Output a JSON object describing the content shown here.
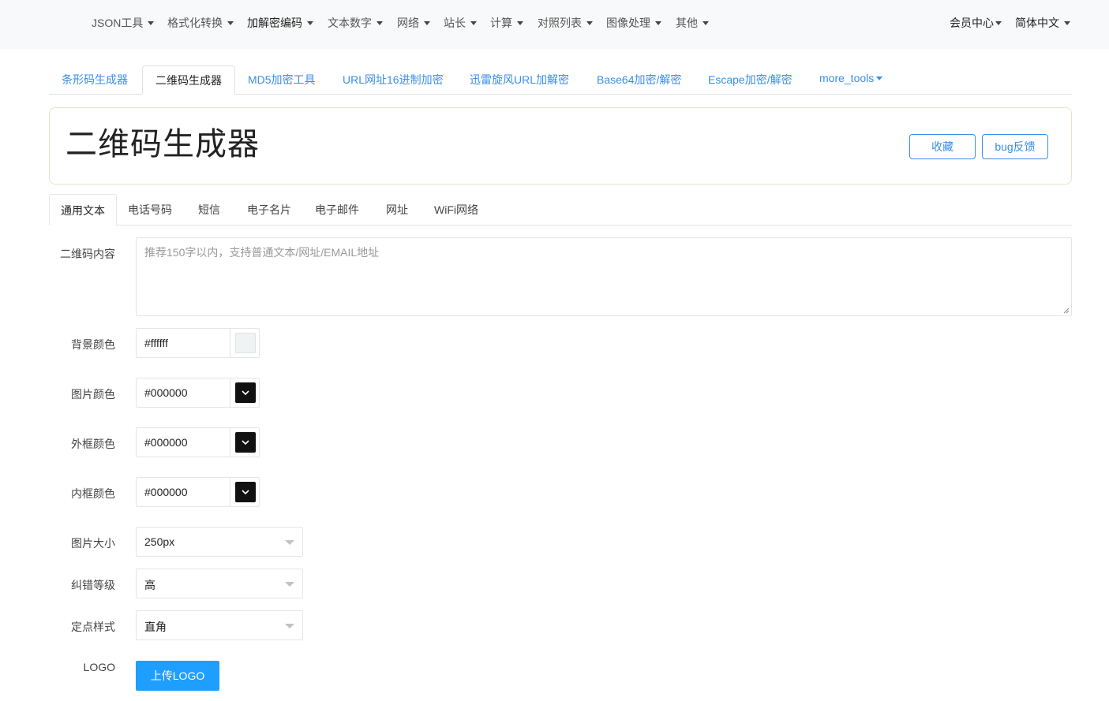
{
  "navbar": {
    "items": [
      {
        "label": "JSON工具"
      },
      {
        "label": "格式化转换"
      },
      {
        "label": "加解密编码"
      },
      {
        "label": "文本数字"
      },
      {
        "label": "网络"
      },
      {
        "label": "站长"
      },
      {
        "label": "计算"
      },
      {
        "label": "对照列表"
      },
      {
        "label": "图像处理"
      },
      {
        "label": "其他"
      }
    ],
    "right": [
      {
        "label": "会员中心"
      },
      {
        "label": "简体中文"
      }
    ]
  },
  "tool_tabs": [
    {
      "label": "条形码生成器"
    },
    {
      "label": "二维码生成器"
    },
    {
      "label": "MD5加密工具"
    },
    {
      "label": "URL网址16进制加密"
    },
    {
      "label": "迅雷旋风URL加解密"
    },
    {
      "label": "Base64加密/解密"
    },
    {
      "label": "Escape加密/解密"
    },
    {
      "label": "more_tools"
    }
  ],
  "header": {
    "title": "二维码生成器",
    "favorite_label": "收藏",
    "bug_label": "bug反馈"
  },
  "qr_tabs": [
    {
      "label": "通用文本"
    },
    {
      "label": "电话号码"
    },
    {
      "label": "短信"
    },
    {
      "label": "电子名片"
    },
    {
      "label": "电子邮件"
    },
    {
      "label": "网址"
    },
    {
      "label": "WiFi网络"
    }
  ],
  "form": {
    "content": {
      "label": "二维码内容",
      "placeholder": "推荐150字以内，支持普通文本/网址/EMAIL地址",
      "value": ""
    },
    "bg_color": {
      "label": "背景颜色",
      "value": "#ffffff"
    },
    "fg_color": {
      "label": "图片颜色",
      "value": "#000000"
    },
    "outer_color": {
      "label": "外框颜色",
      "value": "#000000"
    },
    "inner_color": {
      "label": "内框颜色",
      "value": "#000000"
    },
    "size": {
      "label": "图片大小",
      "value": "250px"
    },
    "ecc": {
      "label": "纠错等级",
      "value": "高"
    },
    "dot_style": {
      "label": "定点样式",
      "value": "直角"
    },
    "logo": {
      "label": "LOGO",
      "button": "上传LOGO"
    }
  },
  "colors": {
    "accent": "#3a8ee6",
    "primary_button": "#1e9fff",
    "navbar_bg": "#f8f9fa"
  }
}
